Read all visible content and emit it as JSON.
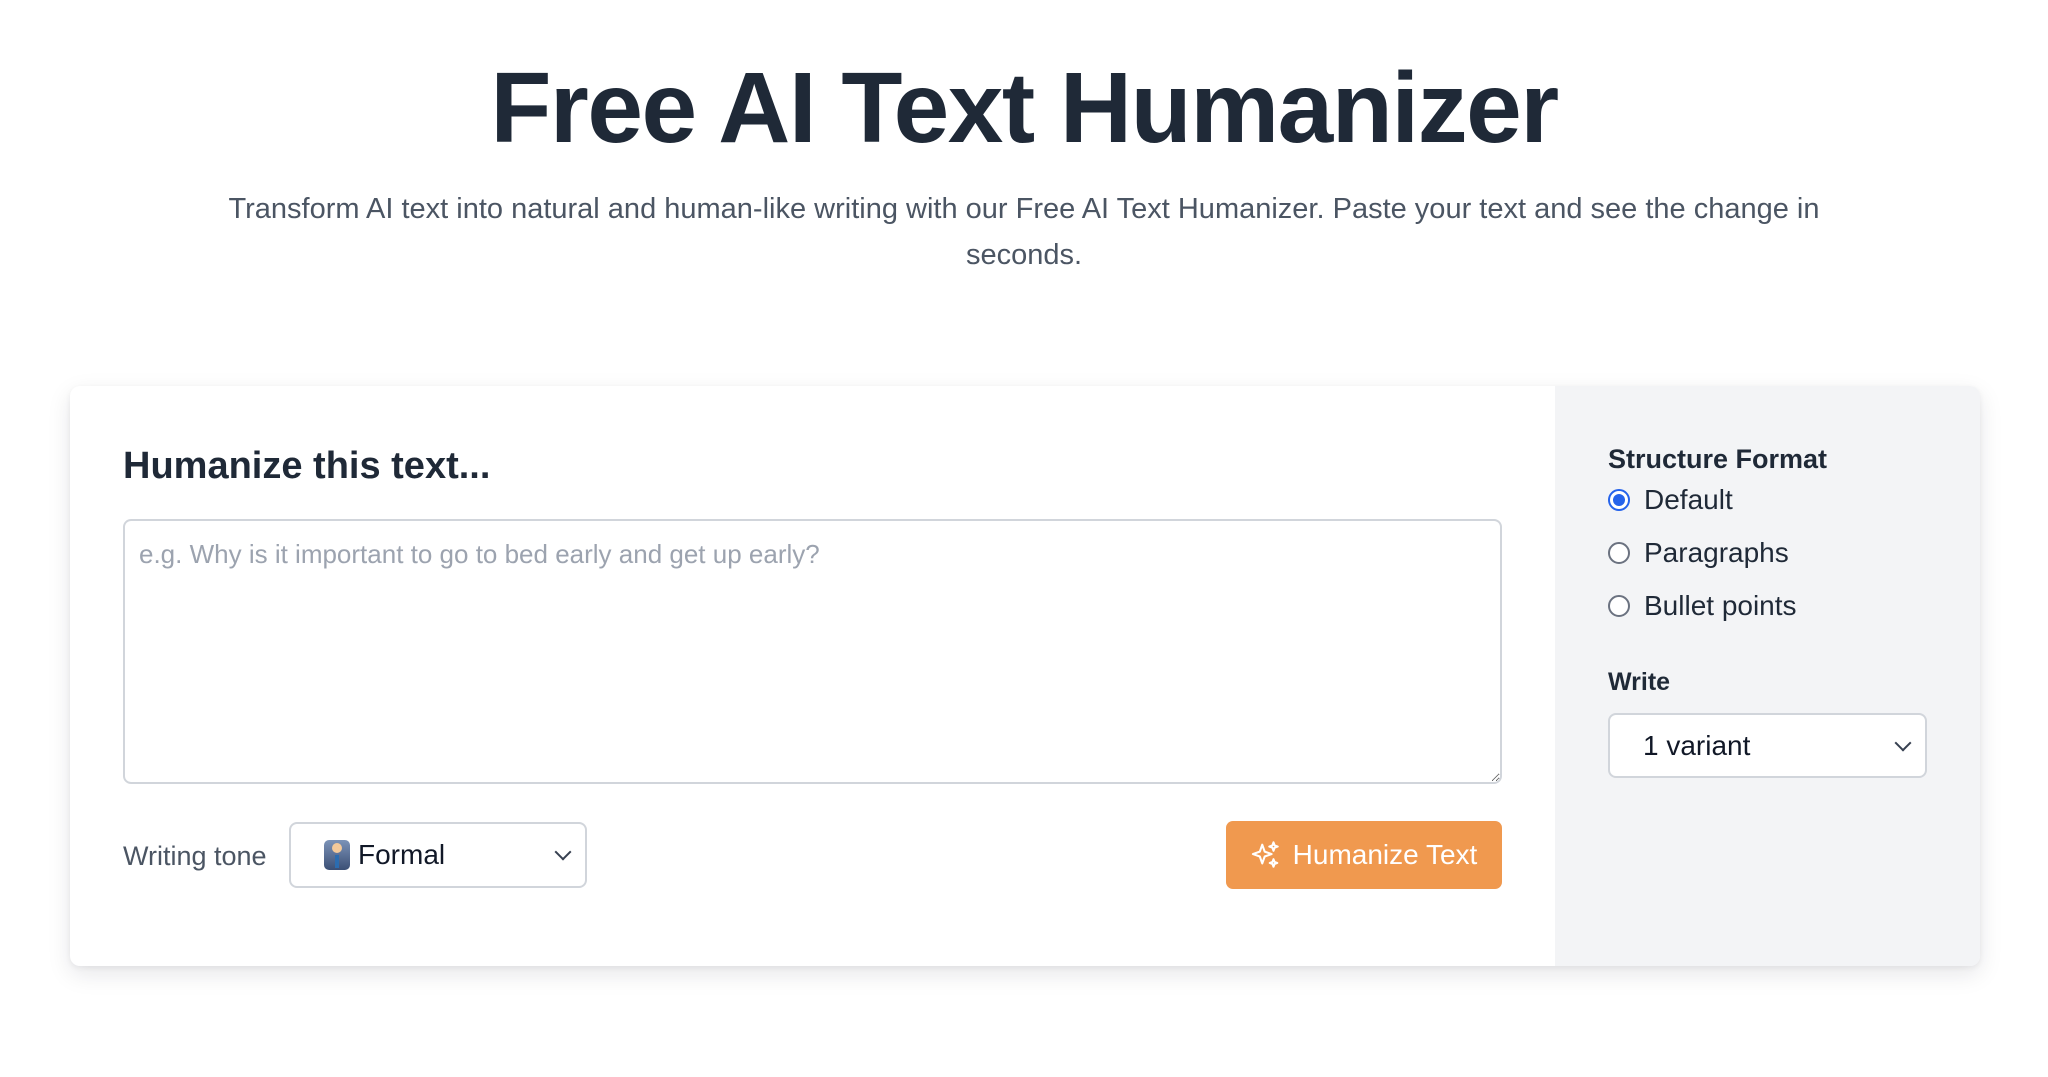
{
  "hero": {
    "title": "Free AI Text Humanizer",
    "subtitle": "Transform AI text into natural and human-like writing with our Free AI Text Humanizer. Paste your text and see the change in seconds."
  },
  "editor": {
    "heading": "Humanize this text...",
    "input_value": "",
    "placeholder": "e.g. Why is it important to go to bed early and get up early?",
    "tone_label": "Writing tone",
    "tone_icon": "office-worker-emoji",
    "tone_value": "Formal",
    "submit_label": "Humanize Text",
    "submit_icon": "sparkles-icon",
    "submit_color": "#f0994f"
  },
  "options": {
    "structure_heading": "Structure Format",
    "structure_options": [
      {
        "label": "Default",
        "selected": true
      },
      {
        "label": "Paragraphs",
        "selected": false
      },
      {
        "label": "Bullet points",
        "selected": false
      }
    ],
    "write_label": "Write",
    "variant_value": "1 variant",
    "accent_color": "#2563eb"
  }
}
